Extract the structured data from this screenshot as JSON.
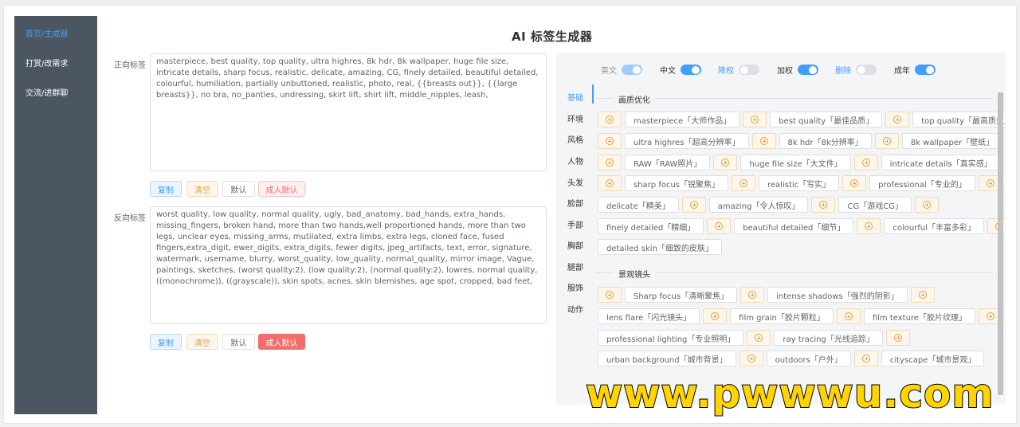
{
  "app": {
    "title": "AI 标签生成器"
  },
  "sidebar": {
    "items": [
      {
        "label": "首页/生成器",
        "active": true
      },
      {
        "label": "打赏/改需求"
      },
      {
        "label": "交流/进群聊"
      }
    ]
  },
  "positive": {
    "label": "正向标签",
    "value": "masterpiece, best quality, top quality, ultra highres, 8k hdr, 8k wallpaper, huge file size, intricate details, sharp focus, realistic, delicate, amazing, CG, finely detailed, beautiful detailed, colourful, humiliation, partially unbuttoned, realistic, photo, real, {{breasts out}}, {{large breasts}}, no bra, no_panties, undressing, skirt lift, shirt lift, middle_nipples, leash,",
    "buttons": {
      "copy": "复制",
      "clear": "清空",
      "default": "默认",
      "adult": "成人默认"
    }
  },
  "negative": {
    "label": "反向标签",
    "value": "worst quality, low quality, normal quality, ugly, bad_anatomy, bad_hands, extra_hands, missing_fingers, broken hand, more than two hands,well proportioned hands, more than two legs, unclear eyes, missing_arms, mutilated, extra limbs, extra legs, cloned face, fused fingers,extra_digit, ewer_digits, extra_digits, fewer digits, jpeg_artifacts, text, error, signature, watermark, username, blurry, worst_quality, low_quality, normal_quality, mirror image, Vague, paintings, sketches, (worst quality:2), (low quality:2), (normal quality:2), lowres, normal quality, ((monochrome)), ((grayscale)), skin spots, acnes, skin blemishes, age spot, cropped, bad feet,",
    "buttons": {
      "copy": "复制",
      "clear": "清空",
      "default": "默认",
      "adult": "成人默认"
    }
  },
  "toggles": [
    {
      "label": "英文",
      "state": "on-light"
    },
    {
      "label": "中文",
      "state": "on"
    },
    {
      "label": "降权",
      "state": "off",
      "accent": true
    },
    {
      "label": "加权",
      "state": "on"
    },
    {
      "label": "删除",
      "state": "off",
      "accent": true
    },
    {
      "label": "成年",
      "state": "on"
    }
  ],
  "categories": [
    "基础",
    "环境",
    "风格",
    "人物",
    "头发",
    "脸部",
    "手部",
    "胸部",
    "腿部",
    "服饰",
    "动作"
  ],
  "sections": [
    {
      "title": "画质优化",
      "rows": [
        [
          "masterpiece「大师作品」",
          "best quality「最佳品质」",
          "top quality「最高质量」"
        ],
        [
          "ultra highres「超高分辨率」",
          "8k hdr「8k分辨率」",
          "8k wallpaper「壁纸」"
        ],
        [
          "RAW「RAW照片」",
          "huge file size「大文件」",
          "intricate details「真实感」"
        ],
        [
          "sharp focus「锐聚焦」",
          "realistic「写实」",
          "professional「专业的」"
        ],
        [
          "delicate「精美」",
          "amazing「令人惊叹」",
          "CG「游戏CG」"
        ],
        [
          "finely detailed「精细」",
          "beautiful detailed「细节」",
          "colourful「丰富多彩」"
        ],
        [
          "detailed skin「细致的皮肤」"
        ]
      ]
    },
    {
      "title": "景观镜头",
      "rows": [
        [
          "Sharp focus「清晰聚焦」",
          "intense shadows「强烈的阴影」"
        ],
        [
          "lens flare「闪光镜头」",
          "film grain「胶片颗粒」",
          "film texture「胶片纹理」"
        ],
        [
          "professional lighting「专业照明」",
          "ray tracing「光线追踪」"
        ],
        [
          "urban background「城市背景」",
          "outdoors「户外」",
          "cityscape「城市景观」"
        ]
      ]
    }
  ],
  "watermark": "www.pwwwu.com"
}
